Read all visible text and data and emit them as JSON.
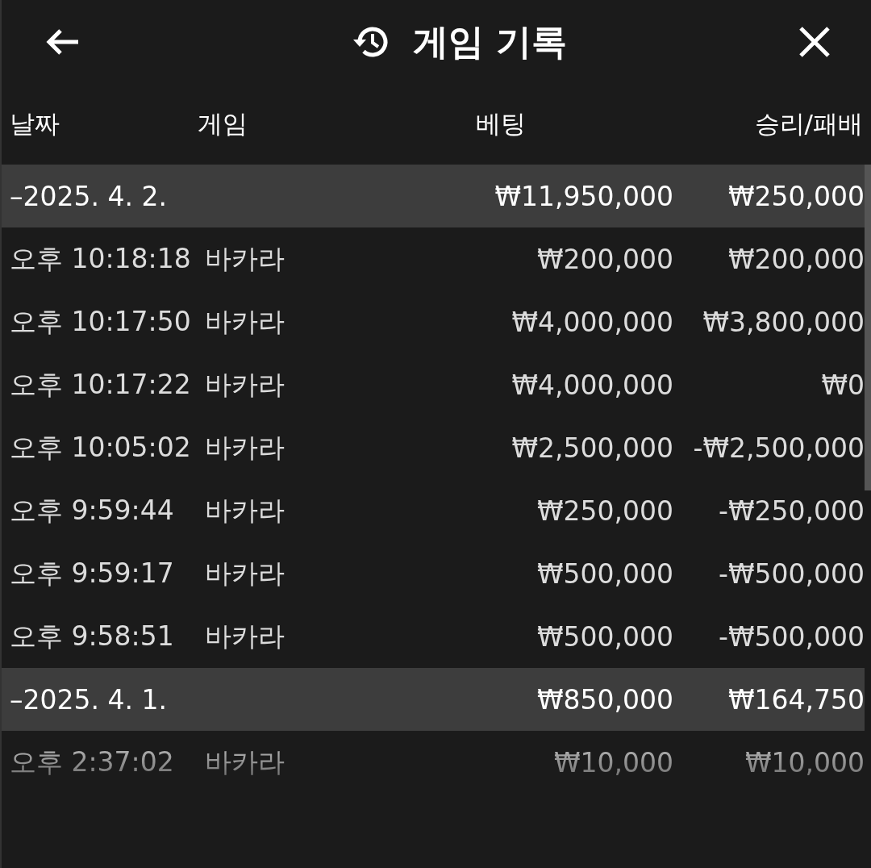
{
  "header": {
    "title": "게임 기록"
  },
  "columns": [
    "날짜",
    "게임",
    "베팅",
    "승리/패배"
  ],
  "groups": [
    {
      "date": "–2025. 4. 2.",
      "bet": "₩11,950,000",
      "result": "₩250,000",
      "rows": [
        {
          "time": "오후 10:18:18",
          "game": "바카라",
          "bet": "₩200,000",
          "result": "₩200,000"
        },
        {
          "time": "오후 10:17:50",
          "game": "바카라",
          "bet": "₩4,000,000",
          "result": "₩3,800,000"
        },
        {
          "time": "오후 10:17:22",
          "game": "바카라",
          "bet": "₩4,000,000",
          "result": "₩0"
        },
        {
          "time": "오후 10:05:02",
          "game": "바카라",
          "bet": "₩2,500,000",
          "result": "-₩2,500,000"
        },
        {
          "time": "오후 9:59:44",
          "game": "바카라",
          "bet": "₩250,000",
          "result": "-₩250,000"
        },
        {
          "time": "오후 9:59:17",
          "game": "바카라",
          "bet": "₩500,000",
          "result": "-₩500,000"
        },
        {
          "time": "오후 9:58:51",
          "game": "바카라",
          "bet": "₩500,000",
          "result": "-₩500,000"
        }
      ]
    },
    {
      "date": "–2025. 4. 1.",
      "bet": "₩850,000",
      "result": "₩164,750",
      "rows": [
        {
          "time": "오후 2:37:02",
          "game": "바카라",
          "bet": "₩10,000",
          "result": "₩10,000"
        }
      ]
    }
  ]
}
